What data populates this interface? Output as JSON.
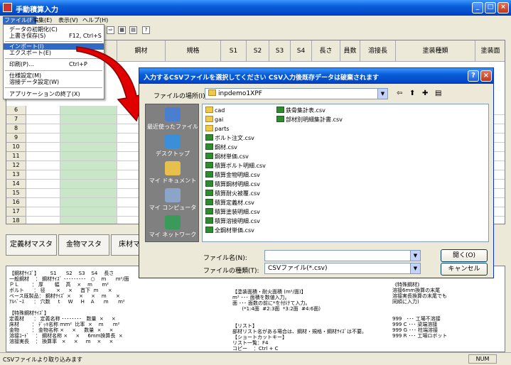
{
  "app": {
    "title": "手動積算入力"
  },
  "menubar": [
    "ファイル(F)",
    "編集(E)",
    "表示(V)",
    "ヘルプ(H)"
  ],
  "file_menu": [
    {
      "label": "データの初期化(C)",
      "shortcut": ""
    },
    {
      "label": "上書き保存(S)",
      "shortcut": "F12, Ctrl+S"
    },
    {
      "label": "インポート(I)",
      "shortcut": ""
    },
    {
      "label": "エクスポート(E)",
      "shortcut": ""
    },
    {
      "label": "印刷(P)...",
      "shortcut": "Ctrl+P"
    },
    {
      "label": "仕様設定(M)",
      "shortcut": ""
    },
    {
      "label": "溶接データ設定(W)",
      "shortcut": ""
    },
    {
      "label": "アプリケーションの終了(X)",
      "shortcut": ""
    }
  ],
  "grid": {
    "headers": [
      "鋼材",
      "規格",
      "S1",
      "S2",
      "S3",
      "S4",
      "長さ(mm)",
      "員数",
      "溶接長",
      "塗装種類",
      "塗装面"
    ],
    "rows": [
      "6",
      "7",
      "8",
      "9",
      "10",
      "11",
      "12",
      "13",
      "14",
      "15",
      "16",
      "17",
      "18",
      "19"
    ]
  },
  "tabs": [
    "定義材マスタ",
    "金物マスタ",
    "床材マ"
  ],
  "info": {
    "col1": "【鋼材ｻｲｽﾞ】       S1      S2    S3    S4    長さ\n一般鋼材    ： 鋼材ｻｲｽﾞ ･････････   ○    m      m²/面\nＰＬ        ： 厚       幅    高    ×    m      m²\nボルト      ： 径       ×     ×     首下  m      ×\nベース既製品： 鋼材ｻｲｽﾞ ×     ×     ×    m      ×\nｱﾙﾍﾞｰｽ      ： 穴数     t     W     H    A      m      m²\n\n【特殊鋼材ｻｲｽﾞ】\n定義材      ： 定義名称 ････････   数量  ×     ×\n床材        ： ﾃﾞｯｷ名称 ｍｍ²  比率  ×    m      m²\n金物        ： 金物名称 ×     ×     数量  ×     ×\n溶接ｺｰﾄﾞ    ： 鋼材名称 ×     ×     6mm換算長  ×\n溶接実長    ： 換算率   ×     ×     m    ×     ×",
    "col2": "【塗装面積・耐火面積 (m²/面)】\nm² ･･･ 面積を数値入力。\n面 ･･･ 面数の前に*を付けて入力。\n      (*1:4面  #2:3面  *3:2面  #4:6面)\n\n\n【リスト】\n部材リスト名がある場合は、鋼材・規格・鋼材ｻｲｽﾞは不要。\n【ショートカットキー】\nリスト一覧：F4\nコピー    ：Ctrl + C\n貼り付け  ：Ctrl + V",
    "col3": "《特殊鋼材》\n溶接6mm換算の末尾\n溶接実長換算の末尾でも\n同順に入力)\n\n\n999   ･･･ 工場不溶接\n999 C ･･･ 梁端溶接\n999 G ･･･ 柱端溶接\n999 R ･･･ 工場ロボット"
  },
  "statusbar": {
    "text": "CSVファイルより取り込みます",
    "num": "NUM"
  },
  "dialog": {
    "title": "入力するCSVファイルを選択してください CSV入力後既存データは破棄されます",
    "look_in_label": "ファイルの場所(I):",
    "look_in_value": "inpdemo1XPF",
    "places": [
      "最近使ったファイル",
      "デスクトップ",
      "マイ ドキュメント",
      "マイ コンピュータ",
      "マイ ネットワーク"
    ],
    "files_col1": [
      {
        "name": "cad",
        "type": "folder"
      },
      {
        "name": "gai",
        "type": "folder"
      },
      {
        "name": "parts",
        "type": "folder"
      },
      {
        "name": "ボルト注文.csv",
        "type": "csv"
      },
      {
        "name": "鋼材.csv",
        "type": "csv"
      },
      {
        "name": "鋼材単価.csv",
        "type": "csv"
      },
      {
        "name": "積算ボルト明細.csv",
        "type": "csv"
      },
      {
        "name": "積算金物明細.csv",
        "type": "csv"
      },
      {
        "name": "積算鋼材明細.csv",
        "type": "csv"
      },
      {
        "name": "積算耐火被覆.csv",
        "type": "csv"
      },
      {
        "name": "積算定義材.csv",
        "type": "csv"
      },
      {
        "name": "積算塗装明細.csv",
        "type": "csv"
      },
      {
        "name": "積算溶接明細.csv",
        "type": "csv"
      },
      {
        "name": "全鋼材単価.csv",
        "type": "csv"
      }
    ],
    "files_col2": [
      {
        "name": "鉄骨集計表.csv",
        "type": "csv"
      },
      {
        "name": "部材別明細集計書.csv",
        "type": "csv"
      }
    ],
    "filename_label": "ファイル名(N):",
    "filename_value": "",
    "filetype_label": "ファイルの種類(T):",
    "filetype_value": "CSVファイル(*.csv)",
    "open_button": "開く(O)",
    "cancel_button": "キャンセル"
  },
  "colors": {
    "grid_green": "#c9e6c9",
    "title_blue": "#0a5fd8",
    "arrow_red": "#e00000"
  }
}
